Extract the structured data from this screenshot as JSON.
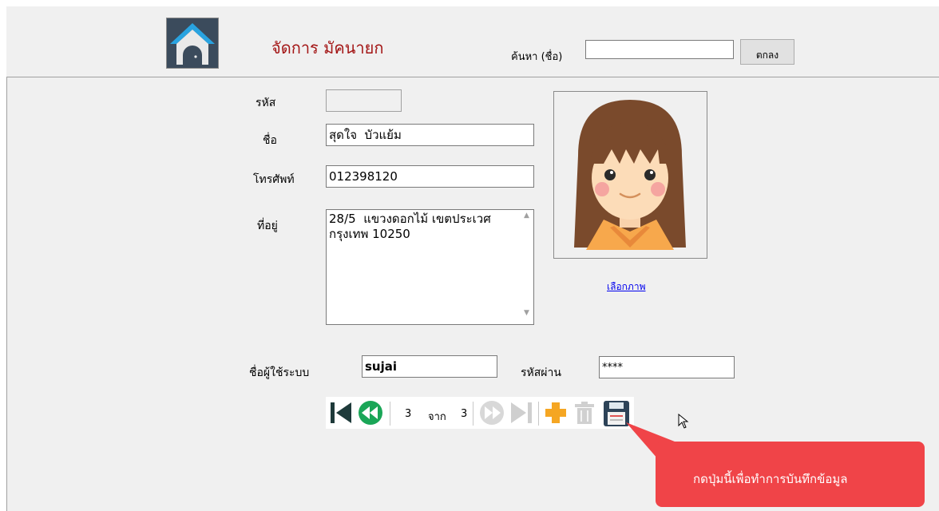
{
  "header": {
    "title": "จัดการ มัคนายก",
    "search_label": "ค้นหา (ชื่อ)",
    "search_value": "",
    "search_button": "ตกลง"
  },
  "form": {
    "id_label": "รหัส",
    "id_value": "",
    "name_label": "ชื่อ",
    "name_value": "สุดใจ  บัวแย้ม",
    "phone_label": "โทรศัพท์",
    "phone_value": "012398120",
    "address_label": "ที่อยู่",
    "address_value": "28/5  แขวงดอกไม้ เขตประเวศ กรุงเทพ 10250",
    "choose_image_link": "เลือกภาพ",
    "username_label": "ชื่อผู้ใช้ระบบ",
    "username_value": "sujai",
    "password_label": "รหัสผ่าน",
    "password_value": "****"
  },
  "navigator": {
    "current": "3",
    "of_label": "จาก",
    "total": "3"
  },
  "callout": {
    "text": "กดปุ่มนี้เพื่อทำการบันทึกข้อมูล"
  },
  "colors": {
    "title": "#a31515",
    "callout_bg": "#f04448",
    "nav_green": "#1aa657",
    "nav_dark": "#1e3a3a",
    "plus_orange": "#f5a623"
  },
  "icons": [
    "home-icon",
    "first-record-icon",
    "previous-record-icon",
    "next-record-icon",
    "last-record-icon",
    "add-icon",
    "delete-icon",
    "save-icon",
    "mouse-cursor-icon"
  ]
}
